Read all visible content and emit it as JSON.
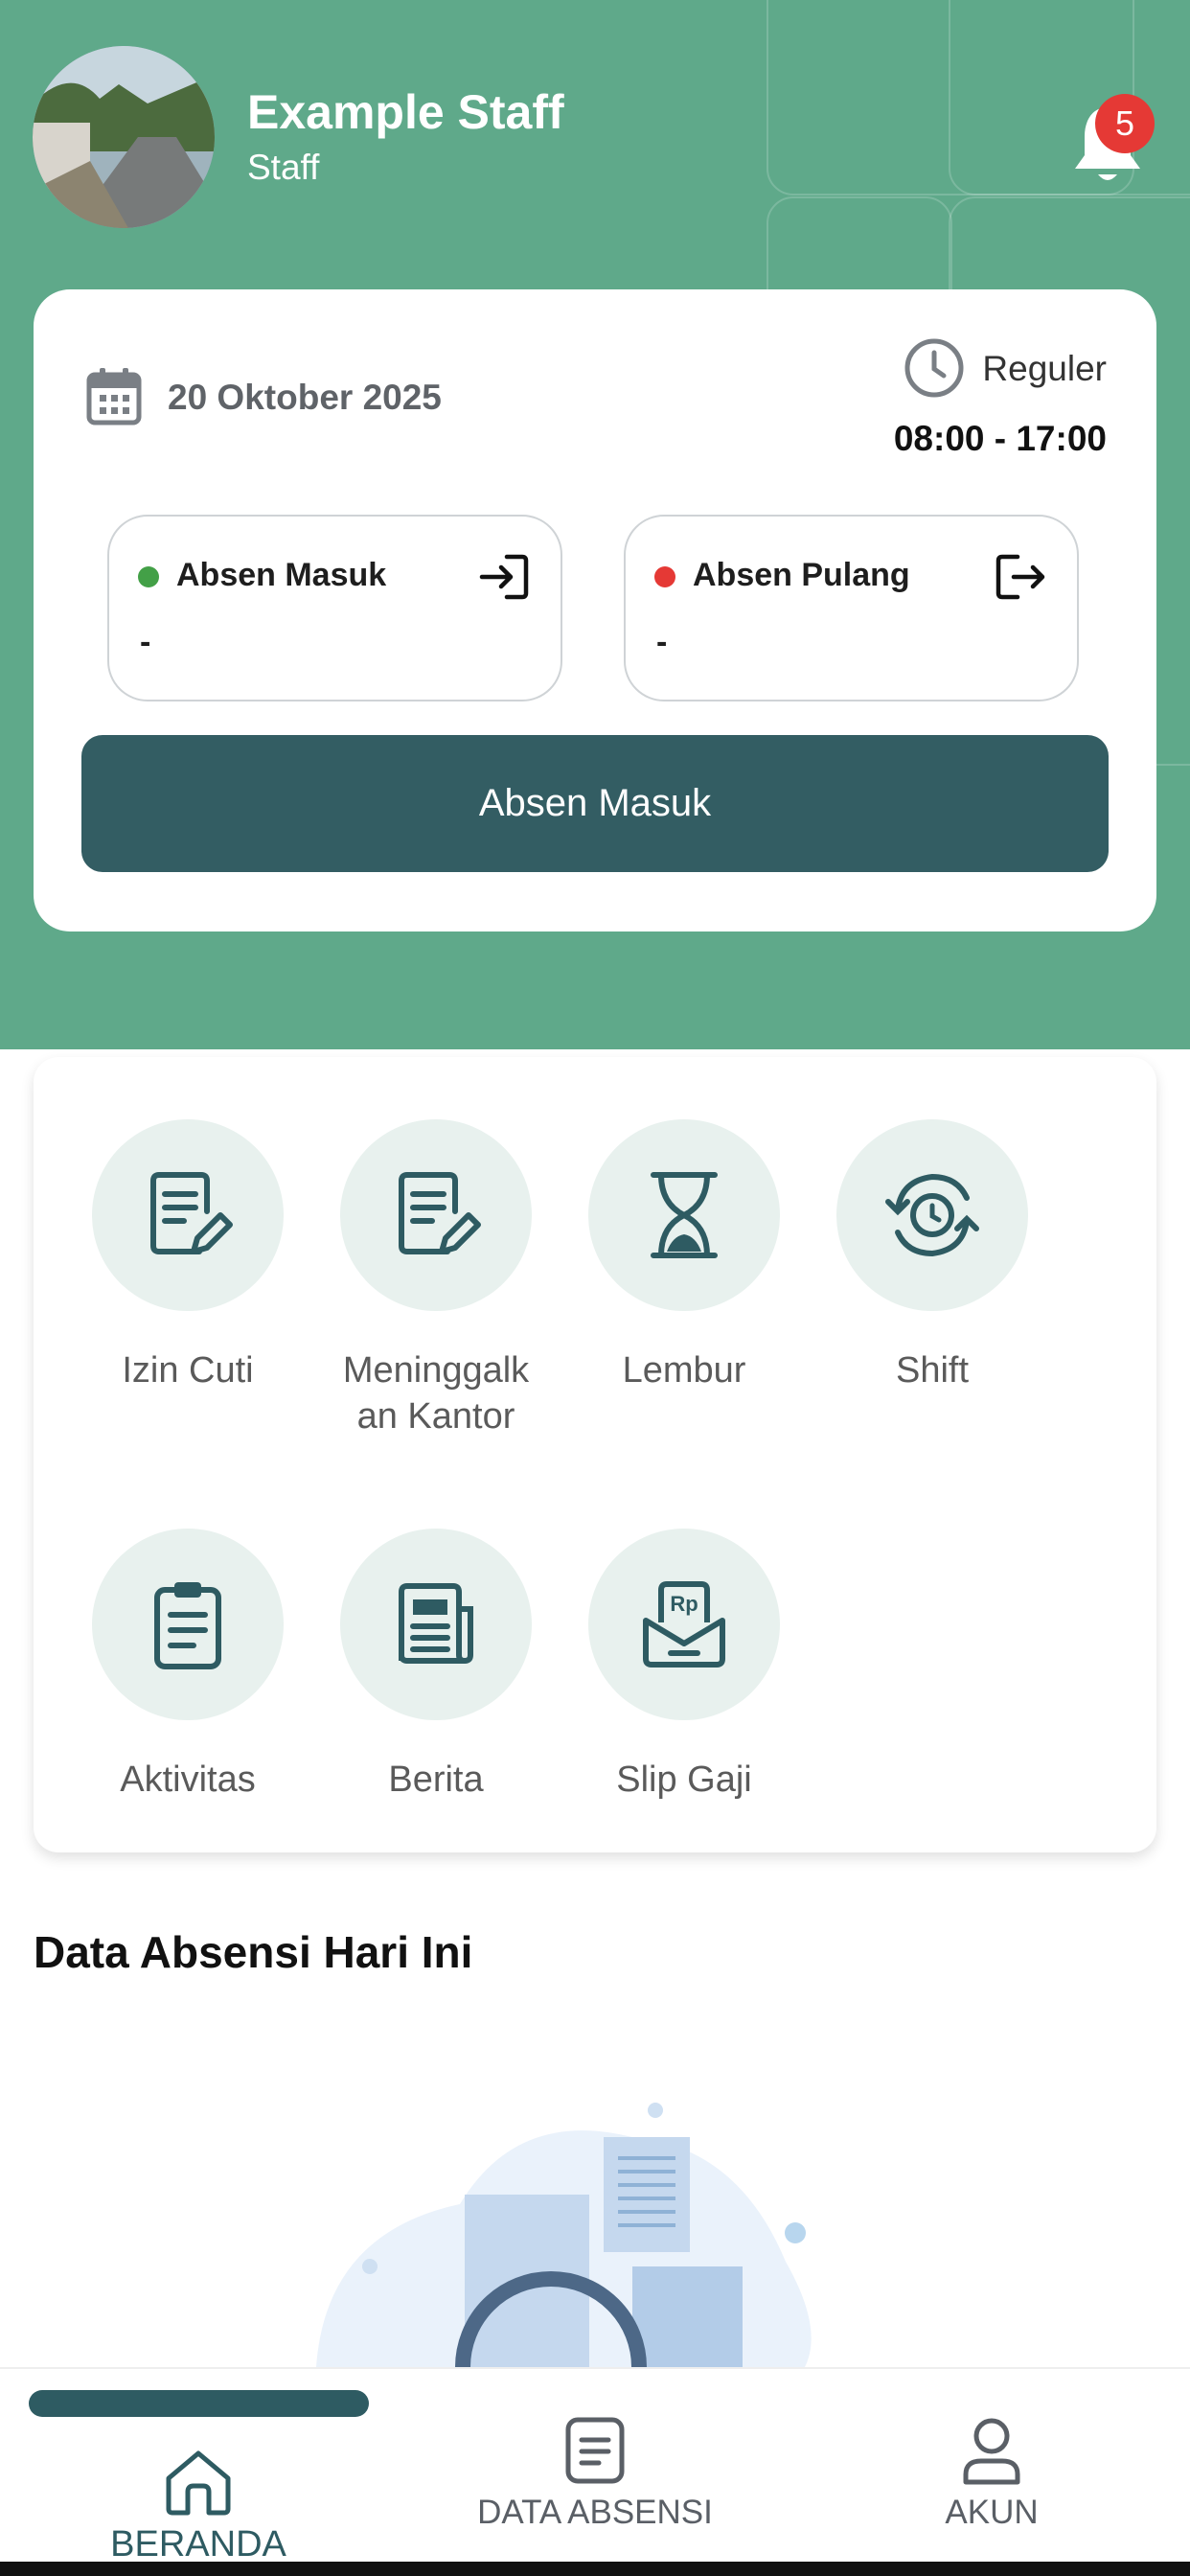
{
  "user": {
    "name": "Example Staff",
    "role": "Staff",
    "notification_count": "5"
  },
  "attendance_card": {
    "date": "20 Oktober 2025",
    "shift_name": "Reguler",
    "shift_time": "08:00 - 17:00",
    "check_in": {
      "label": "Absen Masuk",
      "value": "-",
      "status_color": "#43a047"
    },
    "check_out": {
      "label": "Absen Pulang",
      "value": "-",
      "status_color": "#e53935"
    },
    "primary_button": "Absen Masuk"
  },
  "menu": {
    "items": [
      {
        "label": "Izin Cuti",
        "icon": "document-edit-icon"
      },
      {
        "label": "Meninggalk an Kantor",
        "icon": "document-edit-icon"
      },
      {
        "label": "Lembur",
        "icon": "hourglass-icon"
      },
      {
        "label": "Shift",
        "icon": "clock-rotate-icon"
      },
      {
        "label": "Aktivitas",
        "icon": "clipboard-icon"
      },
      {
        "label": "Berita",
        "icon": "newspaper-icon"
      },
      {
        "label": "Slip Gaji",
        "icon": "payslip-icon"
      }
    ],
    "payslip_currency": "Rp"
  },
  "section": {
    "title": "Data Absensi Hari Ini"
  },
  "nav": {
    "items": [
      {
        "label": "BERANDA",
        "icon": "home-icon",
        "active": true
      },
      {
        "label": "DATA ABSENSI",
        "icon": "document-list-icon",
        "active": false
      },
      {
        "label": "AKUN",
        "icon": "user-icon",
        "active": false
      }
    ]
  },
  "colors": {
    "primary": "#335d63",
    "header": "#5fa98a",
    "icon": "#2e5b62"
  }
}
